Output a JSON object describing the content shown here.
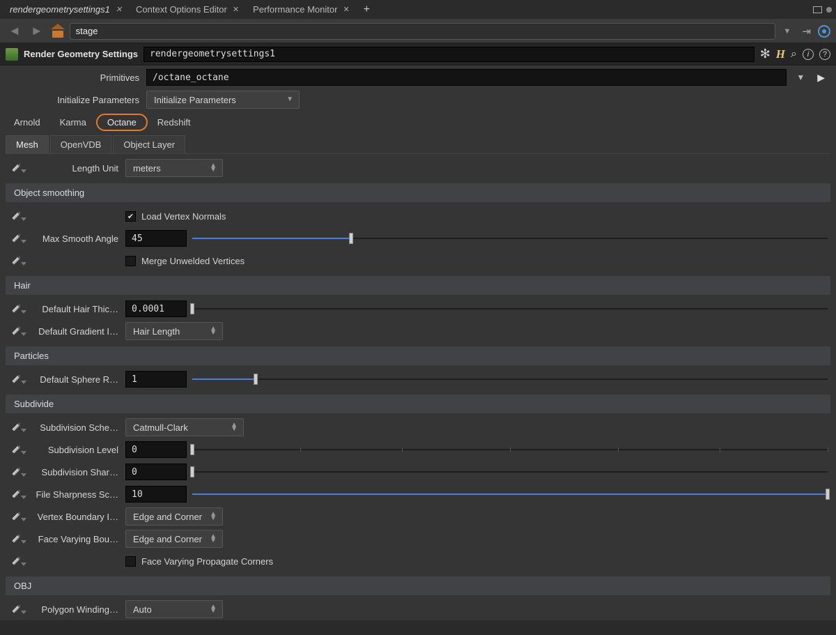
{
  "tabs": {
    "t0": "rendergeometrysettings1",
    "t1": "Context Options Editor",
    "t2": "Performance Monitor"
  },
  "path": "stage",
  "node": {
    "title": "Render Geometry Settings",
    "name": "rendergeometrysettings1"
  },
  "primitives_label": "Primitives",
  "primitives_value": "/octane_octane",
  "init_label": "Initialize Parameters",
  "init_dropdown": "Initialize Parameters",
  "renderer_tabs": {
    "a": "Arnold",
    "b": "Karma",
    "c": "Octane",
    "d": "Redshift"
  },
  "sub_tabs": {
    "mesh": "Mesh",
    "vdb": "OpenVDB",
    "obj": "Object Layer"
  },
  "mesh": {
    "length_unit_label": "Length Unit",
    "length_unit_value": "meters",
    "sec_smooth": "Object smoothing",
    "load_normals": "Load Vertex Normals",
    "max_smooth_label": "Max Smooth Angle",
    "max_smooth_value": "45",
    "merge_unwelded": "Merge Unwelded Vertices",
    "sec_hair": "Hair",
    "hair_thick_label": "Default Hair Thickness",
    "hair_thick_value": "0.0001",
    "grad_interp_label": "Default Gradient Interpolation",
    "grad_interp_value": "Hair Length",
    "sec_particles": "Particles",
    "sphere_radius_label": "Default Sphere Radius",
    "sphere_radius_value": "1",
    "sec_subd": "Subdivide",
    "subd_scheme_label": "Subdivision Scheme",
    "subd_scheme_value": "Catmull-Clark",
    "subd_level_label": "Subdivision Level",
    "subd_level_value": "0",
    "subd_sharp_label": "Subdivision Sharpness",
    "subd_sharp_value": "0",
    "file_sharp_label": "File Sharpness Scale",
    "file_sharp_value": "10",
    "vert_bound_label": "Vertex Boundary Interpolation",
    "vert_bound_value": "Edge and Corner",
    "face_bound_label": "Face Varying Boundary Interpolation",
    "face_bound_value": "Edge and Corner",
    "face_prop": "Face Varying Propagate Corners",
    "sec_obj": "OBJ",
    "poly_wind_label": "Polygon Winding Order",
    "poly_wind_value": "Auto"
  }
}
